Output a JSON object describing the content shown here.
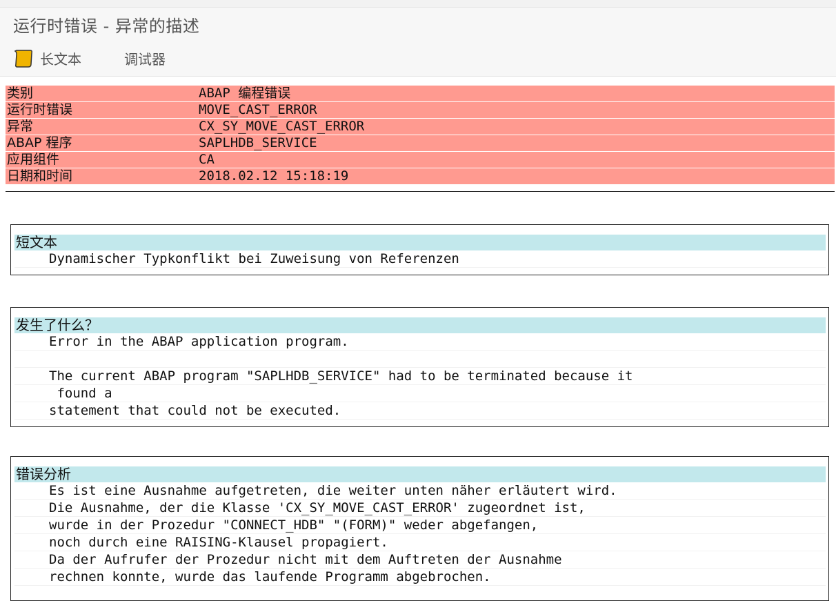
{
  "window": {
    "title": "运行时错误 - 异常的描述"
  },
  "toolbar": {
    "long_text": "长文本",
    "debugger": "调试器"
  },
  "header": {
    "rows": [
      {
        "label": "类别",
        "value": "ABAP 编程错误"
      },
      {
        "label": "运行时错误",
        "value": "MOVE_CAST_ERROR"
      },
      {
        "label": "异常",
        "value": "CX_SY_MOVE_CAST_ERROR"
      },
      {
        "label": "ABAP 程序",
        "value": "SAPLHDB_SERVICE"
      },
      {
        "label": "应用组件",
        "value": "CA"
      },
      {
        "label": "日期和时间",
        "value": "2018.02.12 15:18:19"
      }
    ]
  },
  "sections": {
    "short_text": {
      "title": "短文本",
      "lines": [
        "Dynamischer Typkonflikt bei Zuweisung von Referenzen"
      ]
    },
    "what_happened": {
      "title": "发生了什么？",
      "lines": [
        "Error in the ABAP application program.",
        "",
        "The current ABAP program \"SAPLHDB_SERVICE\" had to be terminated because it",
        " found a",
        "statement that could not be executed."
      ]
    },
    "error_analysis": {
      "title": "错误分析",
      "lines": [
        "Es ist eine Ausnahme aufgetreten, die weiter unten näher erläutert wird.",
        "Die Ausnahme, der die Klasse 'CX_SY_MOVE_CAST_ERROR' zugeordnet ist,",
        "wurde in der Prozedur \"CONNECT_HDB\" \"(FORM)\" weder abgefangen,",
        "noch durch eine RAISING-Klausel propagiert.",
        "Da der Aufrufer der Prozedur nicht mit dem Auftreten der Ausnahme",
        "rechnen konnte, wurde das laufende Programm abgebrochen."
      ]
    }
  }
}
